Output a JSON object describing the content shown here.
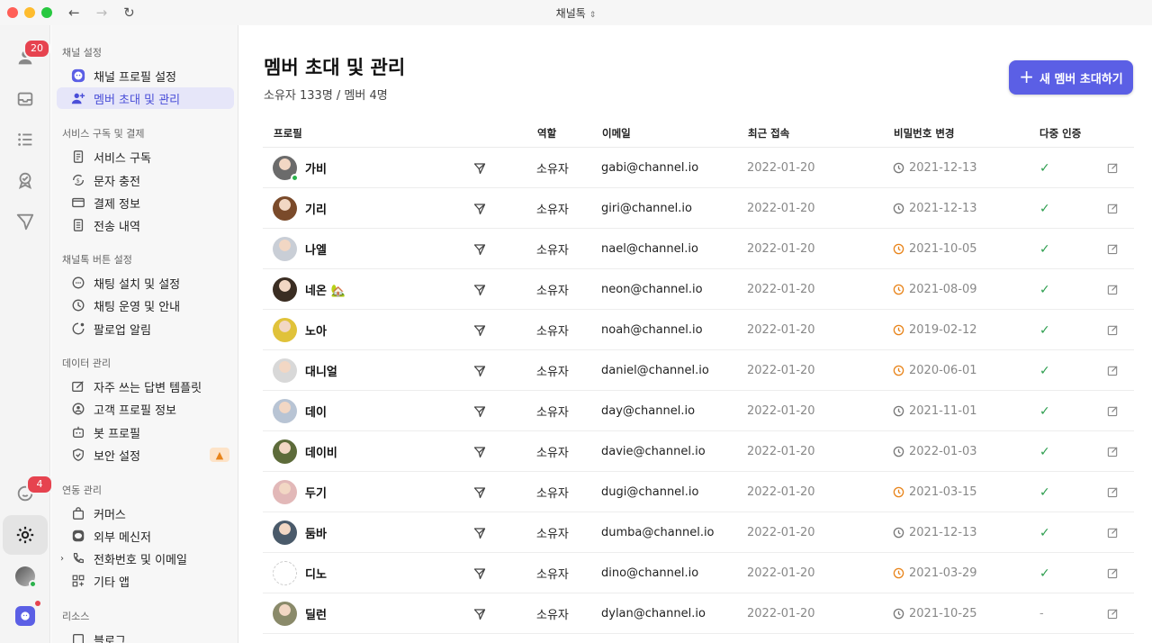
{
  "window": {
    "title": "채널톡"
  },
  "rail": {
    "members_badge": "20",
    "chat_badge": "4"
  },
  "sidebar": {
    "sections": [
      {
        "title": "채널 설정",
        "items": [
          {
            "label": "채널 프로필 설정",
            "icon": "channel-logo-icon"
          },
          {
            "label": "멤버 초대 및 관리",
            "icon": "add-member-icon",
            "active": true
          }
        ]
      },
      {
        "title": "서비스 구독 및 결제",
        "items": [
          {
            "label": "서비스 구독",
            "icon": "document-icon"
          },
          {
            "label": "문자 충전",
            "icon": "refresh-dollar-icon"
          },
          {
            "label": "결제 정보",
            "icon": "credit-card-icon"
          },
          {
            "label": "전송 내역",
            "icon": "receipt-icon"
          }
        ]
      },
      {
        "title": "채널톡 버튼 설정",
        "items": [
          {
            "label": "채팅 설치 및 설정",
            "icon": "chat-bubble-icon"
          },
          {
            "label": "채팅 운영 및 안내",
            "icon": "clock-icon"
          },
          {
            "label": "팔로업 알림",
            "icon": "followup-icon"
          }
        ]
      },
      {
        "title": "데이터 관리",
        "items": [
          {
            "label": "자주 쓰는 답변 템플릿",
            "icon": "template-icon"
          },
          {
            "label": "고객 프로필 정보",
            "icon": "user-circle-icon"
          },
          {
            "label": "봇 프로필",
            "icon": "bot-icon"
          },
          {
            "label": "보안 설정",
            "icon": "shield-icon",
            "warning": "!"
          }
        ]
      },
      {
        "title": "연동 관리",
        "items": [
          {
            "label": "커머스",
            "icon": "shopping-bag-icon"
          },
          {
            "label": "외부 메신저",
            "icon": "messenger-icon"
          },
          {
            "label": "전화번호 및 이메일",
            "icon": "phone-icon",
            "expandable": true
          },
          {
            "label": "기타 앱",
            "icon": "apps-grid-icon"
          }
        ]
      },
      {
        "title": "리소스",
        "items": [
          {
            "label": "블로그",
            "icon": "blog-icon"
          }
        ]
      }
    ]
  },
  "main": {
    "title": "멤버 초대 및 관리",
    "subtitle": "소유자 133명 / 멤버 4명",
    "invite_button": "새 멤버 초대하기",
    "columns": {
      "profile": "프로필",
      "role": "역할",
      "email": "이메일",
      "last_access": "최근 접속",
      "password_change": "비밀번호 변경",
      "mfa": "다중 인증"
    },
    "colors": {
      "accent": "#5b5fe5",
      "warn": "#e8841a",
      "check": "#2e9e4f"
    },
    "members": [
      {
        "name": "가비",
        "role": "소유자",
        "email": "gabi@channel.io",
        "last": "2022-01-20",
        "pw": "2021-12-13",
        "pw_warn": false,
        "mfa": "✓",
        "online": true,
        "avatar": "#6b6b6b"
      },
      {
        "name": "기리",
        "role": "소유자",
        "email": "giri@channel.io",
        "last": "2022-01-20",
        "pw": "2021-12-13",
        "pw_warn": false,
        "mfa": "✓",
        "online": false,
        "avatar": "#7a4a2a"
      },
      {
        "name": "나엘",
        "role": "소유자",
        "email": "nael@channel.io",
        "last": "2022-01-20",
        "pw": "2021-10-05",
        "pw_warn": true,
        "mfa": "✓",
        "online": false,
        "avatar": "#c9ced6"
      },
      {
        "name": "네온 🏡",
        "role": "소유자",
        "email": "neon@channel.io",
        "last": "2022-01-20",
        "pw": "2021-08-09",
        "pw_warn": true,
        "mfa": "✓",
        "online": false,
        "avatar": "#3a2d22"
      },
      {
        "name": "노아",
        "role": "소유자",
        "email": "noah@channel.io",
        "last": "2022-01-20",
        "pw": "2019-02-12",
        "pw_warn": true,
        "mfa": "✓",
        "online": false,
        "avatar": "#e0c23a"
      },
      {
        "name": "대니얼",
        "role": "소유자",
        "email": "daniel@channel.io",
        "last": "2022-01-20",
        "pw": "2020-06-01",
        "pw_warn": true,
        "mfa": "✓",
        "online": false,
        "avatar": "#d8d8d8"
      },
      {
        "name": "데이",
        "role": "소유자",
        "email": "day@channel.io",
        "last": "2022-01-20",
        "pw": "2021-11-01",
        "pw_warn": false,
        "mfa": "✓",
        "online": false,
        "avatar": "#b8c4d4"
      },
      {
        "name": "데이비",
        "role": "소유자",
        "email": "davie@channel.io",
        "last": "2022-01-20",
        "pw": "2022-01-03",
        "pw_warn": false,
        "mfa": "✓",
        "online": false,
        "avatar": "#5d6b3a"
      },
      {
        "name": "두기",
        "role": "소유자",
        "email": "dugi@channel.io",
        "last": "2022-01-20",
        "pw": "2021-03-15",
        "pw_warn": true,
        "mfa": "✓",
        "online": false,
        "avatar": "#e2b8b8"
      },
      {
        "name": "둠바",
        "role": "소유자",
        "email": "dumba@channel.io",
        "last": "2022-01-20",
        "pw": "2021-12-13",
        "pw_warn": false,
        "mfa": "✓",
        "online": false,
        "avatar": "#4a5a6a"
      },
      {
        "name": "디노",
        "role": "소유자",
        "email": "dino@channel.io",
        "last": "2022-01-20",
        "pw": "2021-03-29",
        "pw_warn": true,
        "mfa": "✓",
        "online": false,
        "avatar": "#ffffff"
      },
      {
        "name": "딜런",
        "role": "소유자",
        "email": "dylan@channel.io",
        "last": "2022-01-20",
        "pw": "2021-10-25",
        "pw_warn": false,
        "mfa": "-",
        "online": false,
        "avatar": "#8a8a6a"
      }
    ]
  }
}
